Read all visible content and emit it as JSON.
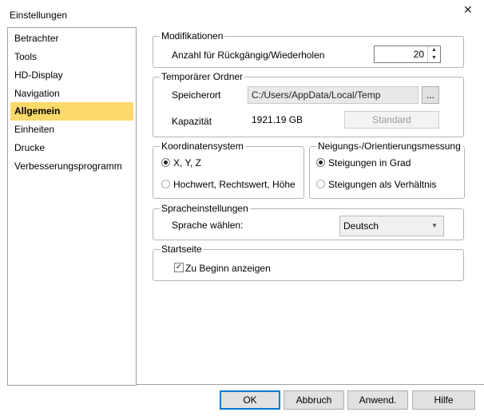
{
  "window": {
    "title": "Einstellungen",
    "close_glyph": "✕"
  },
  "sidebar": {
    "items": [
      {
        "label": "Betrachter"
      },
      {
        "label": "Tools"
      },
      {
        "label": "HD-Display"
      },
      {
        "label": "Navigation"
      },
      {
        "label": "Allgemein",
        "active": true
      },
      {
        "label": "Einheiten"
      },
      {
        "label": "Drucke"
      },
      {
        "label": "Verbesserungsprogramm"
      }
    ]
  },
  "modifications": {
    "legend": "Modifikationen",
    "undo_label": "Anzahl für Rückgängig/Wiederholen",
    "undo_value": "20"
  },
  "temp_folder": {
    "legend": "Temporärer Ordner",
    "location_label": "Speicherort",
    "location_value": "C:/Users/AppData/Local/Temp",
    "browse_label": "...",
    "capacity_label": "Kapazität",
    "capacity_value": "1921.19 GB",
    "standard_label": "Standard"
  },
  "coordinate_system": {
    "legend": "Koordinatensystem",
    "option1": "X, Y, Z",
    "option2": "Hochwert, Rechtswert, Höhe"
  },
  "slope": {
    "legend": "Neigungs-/Orientierungsmessung",
    "option1": "Steigungen in Grad",
    "option2": "Steigungen als Verhältnis"
  },
  "language": {
    "legend": "Spracheinstellungen",
    "label": "Sprache wählen:",
    "value": "Deutsch"
  },
  "startpage": {
    "legend": "Startseite",
    "checkbox_label": "Zu Beginn anzeigen",
    "checked": true
  },
  "footer": {
    "ok_label": "OK",
    "cancel_label": "Abbruch",
    "apply_label": "Anwend.",
    "help_label": "Hilfe"
  }
}
